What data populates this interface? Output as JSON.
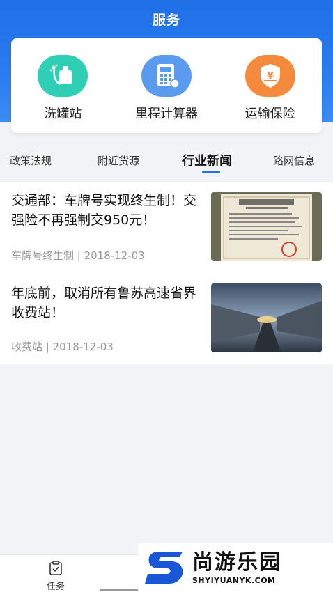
{
  "header": {
    "title": "服务"
  },
  "services": [
    {
      "label": "洗罐站",
      "icon": "wash-tank-icon",
      "color": "#2fcfb6"
    },
    {
      "label": "里程计算器",
      "icon": "calculator-icon",
      "color": "#5b9bef"
    },
    {
      "label": "运输保险",
      "icon": "insurance-shield-icon",
      "color": "#f58a3c"
    }
  ],
  "tabs": [
    {
      "label": "政策法规"
    },
    {
      "label": "附近货源"
    },
    {
      "label": "行业新闻",
      "active": true
    },
    {
      "label": "路网信息"
    }
  ],
  "news": [
    {
      "title": "交通部：车牌号实现终生制！交强险不再强制交950元！",
      "tag": "车牌号终生制",
      "date": "2018-12-03",
      "image": "authorization-certificate"
    },
    {
      "title": "年底前，取消所有鲁苏高速省界收费站！",
      "tag": "收费站",
      "date": "2018-12-03",
      "image": "highway-trucks"
    }
  ],
  "meta_separator": " | ",
  "bottom_nav": {
    "task_label": "任务"
  },
  "watermark": {
    "cn": "尚游乐园",
    "en": "SHYIYUANYK.COM"
  },
  "colors": {
    "primary": "#1f6fe6",
    "watermark_blue": "#1a57d6"
  }
}
